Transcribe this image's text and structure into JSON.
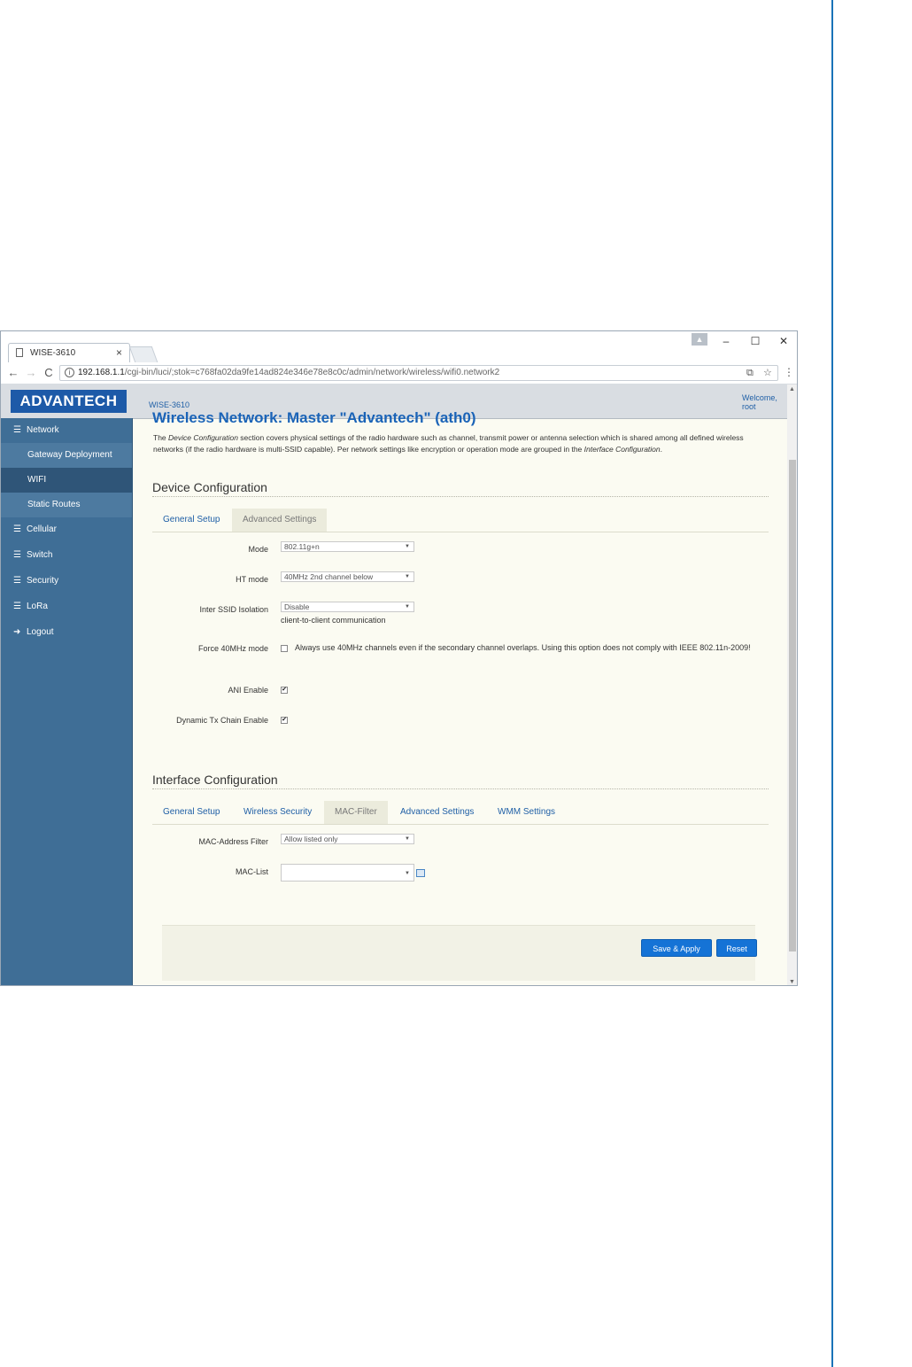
{
  "browser": {
    "tab_title": "WISE-3610",
    "tab_close": "×",
    "url_host": "192.168.1.1",
    "url_path": "/cgi-bin/luci/;stok=c768fa02da9fe14ad824e346e78e8c0c/admin/network/wireless/wifi0.network2",
    "window_controls": {
      "minimize": "–",
      "maximize": "☐",
      "close": "✕"
    },
    "nav": {
      "back": "←",
      "forward": "→",
      "reload": "C"
    }
  },
  "header": {
    "logo": "ADVANTECH",
    "model": "WISE-3610",
    "welcome_line1": "Welcome,",
    "welcome_line2": "root"
  },
  "sidebar": {
    "items": [
      {
        "label": "Network",
        "type": "top"
      },
      {
        "label": "Gateway Deployment",
        "type": "sub"
      },
      {
        "label": "WIFI",
        "type": "sub",
        "active": true
      },
      {
        "label": "Static Routes",
        "type": "sub"
      },
      {
        "label": "Cellular",
        "type": "top"
      },
      {
        "label": "Switch",
        "type": "top"
      },
      {
        "label": "Security",
        "type": "top"
      },
      {
        "label": "LoRa",
        "type": "top"
      },
      {
        "label": "Logout",
        "type": "top"
      }
    ]
  },
  "main": {
    "title": "Wireless Network: Master \"Advantech\" (ath0)",
    "description": {
      "part1": "The ",
      "italic1": "Device Configuration",
      "part2": " section covers physical settings of the radio hardware such as channel, transmit power or antenna selection which is shared among all defined wireless networks (if the radio hardware is multi-SSID capable). Per network settings like encryption or operation mode are grouped in the ",
      "italic2": "Interface Configuration",
      "part3": "."
    },
    "device_config": {
      "title": "Device Configuration",
      "tabs": [
        "General Setup",
        "Advanced Settings"
      ],
      "fields": {
        "mode_label": "Mode",
        "mode_value": "802.11g+n",
        "ht_label": "HT mode",
        "ht_value": "40MHz 2nd channel below",
        "isolation_label": "Inter SSID Isolation",
        "isolation_value": "Disable",
        "isolation_help": "client-to-client communication",
        "force_label": "Force 40MHz mode",
        "force_text": "Always use 40MHz channels even if the secondary channel overlaps. Using this option does not comply with IEEE 802.11n-2009!",
        "ani_label": "ANI Enable",
        "dyn_label": "Dynamic Tx Chain Enable"
      }
    },
    "interface_config": {
      "title": "Interface Configuration",
      "tabs": [
        "General Setup",
        "Wireless Security",
        "MAC-Filter",
        "Advanced Settings",
        "WMM Settings"
      ],
      "fields": {
        "mac_filter_label": "MAC-Address Filter",
        "mac_filter_value": "Allow listed only",
        "mac_list_label": "MAC-List",
        "mac_list_value": ""
      }
    },
    "buttons": {
      "save_apply": "Save & Apply",
      "reset": "Reset"
    }
  }
}
